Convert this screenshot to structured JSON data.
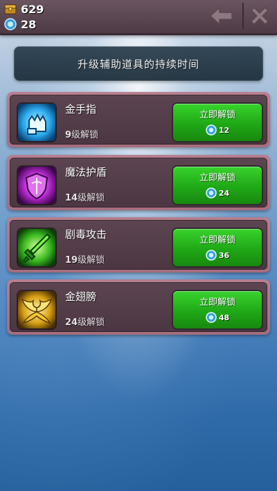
{
  "header": {
    "gold": "629",
    "gems": "28",
    "gold_icon": "treasure-chest-icon",
    "gem_icon": "blue-gem-icon",
    "back_icon": "back-arrow-icon",
    "close_icon": "close-x-icon"
  },
  "banner": {
    "title": "升级辅助道具的持续时间"
  },
  "items": [
    {
      "name": "金手指",
      "level_num": "9",
      "level_suffix": "级解锁",
      "button_label": "立即解锁",
      "cost": "12",
      "icon": "golden-fist-icon",
      "icon_color": "#3fb8ff"
    },
    {
      "name": "魔法护盾",
      "level_num": "14",
      "level_suffix": "级解锁",
      "button_label": "立即解锁",
      "cost": "24",
      "icon": "magic-shield-icon",
      "icon_color": "#c23ad8"
    },
    {
      "name": "剧毒攻击",
      "level_num": "19",
      "level_suffix": "级解锁",
      "button_label": "立即解锁",
      "cost": "36",
      "icon": "poison-sword-icon",
      "icon_color": "#3cc52a"
    },
    {
      "name": "金翅膀",
      "level_num": "24",
      "level_suffix": "级解锁",
      "button_label": "立即解锁",
      "cost": "48",
      "icon": "golden-wings-icon",
      "icon_color": "#e3b21c"
    }
  ],
  "colors": {
    "button_green": "#1fa816",
    "card_frame": "#a56d7d",
    "card_inner": "#4b3641"
  }
}
